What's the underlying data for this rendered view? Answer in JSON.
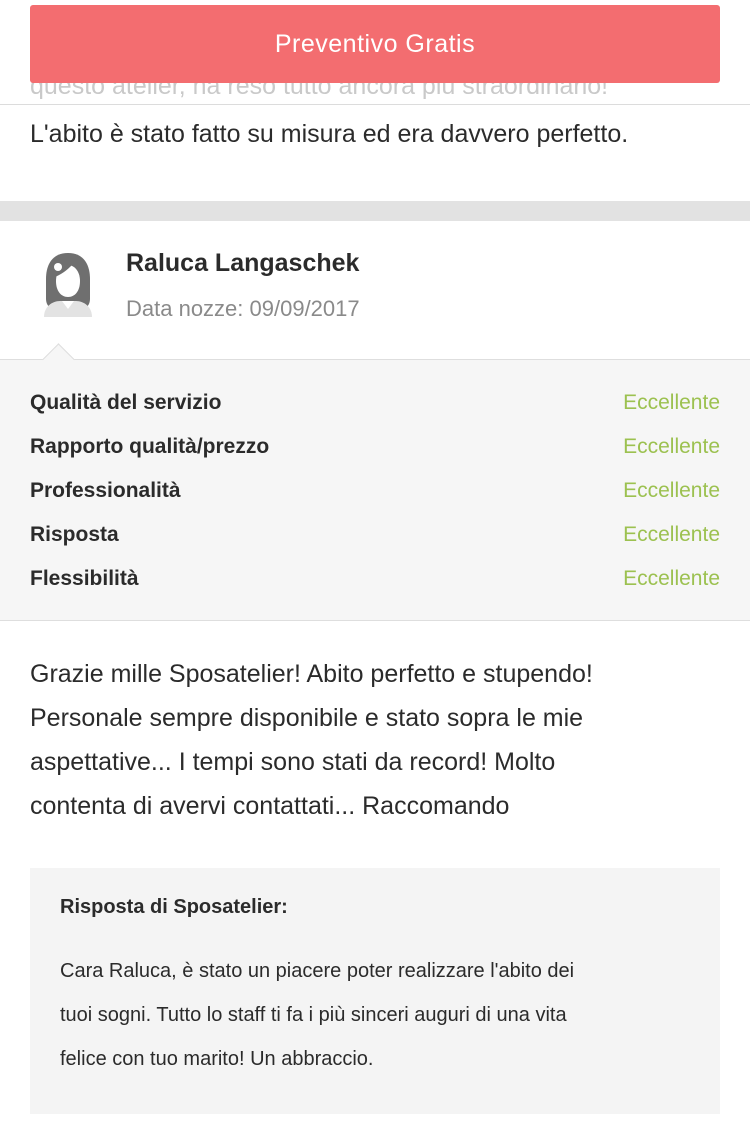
{
  "cta": {
    "label": "Preventivo Gratis"
  },
  "previous_review": {
    "faded_line": "questo atelier, ha reso tutto ancora più straordinario!",
    "last_line": "L'abito è stato fatto su misura ed era davvero perfetto."
  },
  "review": {
    "reviewer_name": "Raluca Langaschek",
    "wedding_date_label": "Data nozze: ",
    "wedding_date": "09/09/2017",
    "avatar_icon": "bride-avatar-icon",
    "ratings": [
      {
        "label": "Qualità del servizio",
        "value": "Eccellente"
      },
      {
        "label": "Rapporto qualità/prezzo",
        "value": "Eccellente"
      },
      {
        "label": "Professionalità",
        "value": "Eccellente"
      },
      {
        "label": "Risposta",
        "value": "Eccellente"
      },
      {
        "label": "Flessibilità",
        "value": "Eccellente"
      }
    ],
    "text_lines": [
      "Grazie mille Sposatelier! Abito perfetto e stupendo!",
      "Personale sempre disponibile e stato sopra le mie",
      "aspettative... I tempi sono stati da record! Molto",
      "contenta di avervi contattati... Raccomando"
    ],
    "answer": {
      "title": "Risposta di Sposatelier:",
      "lines": [
        "Cara Raluca, è stato un piacere poter realizzare l'abito dei",
        "tuoi sogni. Tutto lo staff ti fa i più sinceri auguri di una vita",
        "felice con tuo marito! Un abbraccio."
      ]
    }
  },
  "colors": {
    "cta": "#f36d70",
    "rating_value": "#9cc150",
    "ratings_bg": "#f6f6f6",
    "answer_bg": "#f4f4f4"
  }
}
